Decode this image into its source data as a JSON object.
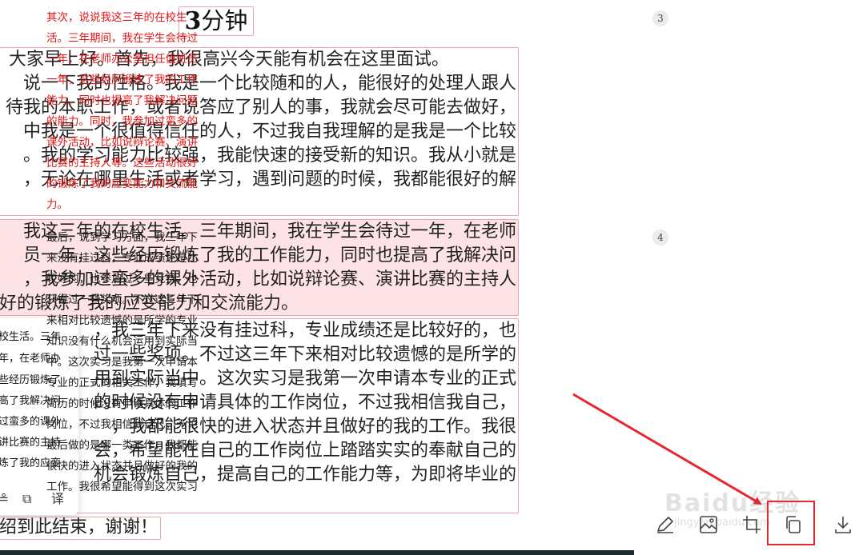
{
  "document": {
    "title_number": "3",
    "title_text": "分钟",
    "paragraph1": [
      "大家早上好。首先，我很高兴今天能有机会在这里面试。",
      "说一下我的性格。我是一个比较随和的人，能很好的处理人跟人",
      "待我的本职工作，或者说答应了别人的事，我就会尽可能去做好，",
      "中我是一个很值得信任的人，不过我自我理解的是我是一个比较",
      "。我的学习能力比较强，我能快速的接受新的知识。我从小就是",
      "，无论在哪里生活或者学习，遇到问题的时候，我都能很好的解"
    ],
    "paragraph2": [
      "我这三年的在校生活。三年期间，我在学生会待过一年，在老师",
      "员一年，这些经历锻炼了我的工作能力，同时也提高了我解决问",
      "，我参加过蛮多的课外活动，比如说辩论赛、演讲比赛的主持人",
      "好的锻炼了我的应变能力和交流能力。"
    ],
    "paragraph3": [
      "，我三年下来没有挂过科，专业成绩还是比较好的，也",
      "过一些奖项。不过这三年下来相对比较遗憾的是所学的",
      "用到实际当中。这次实习是我第一次申请本专业的正式",
      "的时候没有申请具体的工作岗位，不过我相信我自己，",
      "，我都能很快的进入状态并且做好的我的工作。我很",
      "会，希望能在自己的工作岗位上踏踏实实的奉献自己的",
      "机会锻炼自己，提高自己的工作能力等，为即将毕业的"
    ],
    "closing": "绍到此结束，谢谢！"
  },
  "popup": {
    "lines": [
      "校生活。三年",
      "年，在老师办",
      "些经历锻炼了",
      "高了我解决问",
      "过蛮多的课外",
      "讲比赛的主持",
      "炼了我的应变"
    ],
    "tools": [
      "≗",
      "⧉",
      "译"
    ]
  },
  "panel": {
    "item3": {
      "number": "3",
      "lines": [
        "其次，说说我这三年的在校生",
        "活。三年期间，我在学生会待过",
        "一年，在老师办公室担任值班员",
        "一年，这些经历锻炼了我的工作",
        "能力，同时也提高了我解决问题",
        "的能力。同时，我参加过蛮多的",
        "课外活动，比如说辩论赛、演讲",
        "比赛的主持人等。这些活动很好",
        "的锻炼了我的应变能力和交流能",
        "力。"
      ]
    },
    "item4": {
      "number": "4",
      "lines": [
        "最后，说到学习方面，我三年下",
        "来没有挂过科，专业成绩还是比",
        "较好的，也参加过一些竞赛，也",
        "获得过一些奖项。不过这三年下",
        "来相对比较遗憾的是所学的专业",
        "知识没有什么机会运用到实际当",
        "中。这次实习是我第一次申请本",
        "专业的正式的相关工作，我填写",
        "简历的时候没有申请具体的工作",
        "岗位，不过我相信我自己，无论",
        "最后做的是哪一类工作，我都能",
        "很快的进入状态并且做好的我的",
        "工作。我很希望能得到这次实习"
      ]
    },
    "toolbar": [
      "edit-icon",
      "image-scan-icon",
      "crop-icon",
      "copy-icon",
      "download-icon"
    ]
  },
  "watermark": {
    "main": "Baidu经验",
    "sub": "jingyan.baidu.com"
  },
  "colors": {
    "highlight": "#fde3e6",
    "border": "#f2a4ae",
    "red_text": "#e31414",
    "annotation": "#e8262f"
  }
}
